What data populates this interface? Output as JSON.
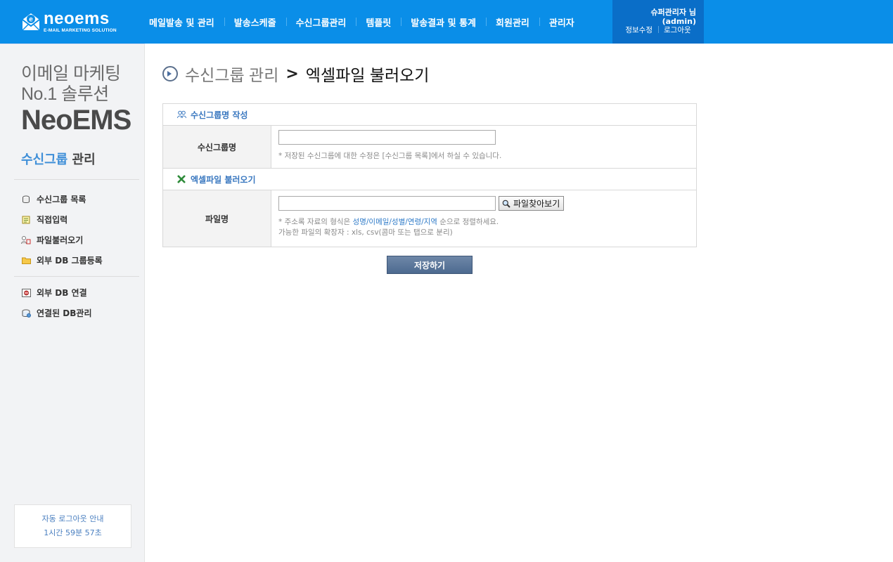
{
  "header": {
    "logo_name": "neoems",
    "logo_sub": "E-MAIL MARKETING SOLUTION",
    "nav": [
      "메일발송 및 관리",
      "발송스케줄",
      "수신그룹관리",
      "템플릿",
      "발송결과 및 통계",
      "회원관리",
      "관리자"
    ],
    "user": {
      "name": "슈퍼관리자 님",
      "id": "(admin)",
      "links": [
        "정보수정",
        "로그아웃"
      ]
    }
  },
  "sidebar": {
    "promo": [
      "이메일 마케팅",
      "No.1 솔루션",
      "NeoEMS"
    ],
    "title_a": "수신그룹",
    "title_b": "관리",
    "menu1": [
      "수신그룹 목록",
      "직접입력",
      "파일불러오기",
      "외부 DB 그룹등록"
    ],
    "menu2": [
      "외부 DB 연결",
      "연결된 DB관리"
    ],
    "logout_notice": "자동 로그아웃 안내",
    "logout_timer": "1시간 59분 57초"
  },
  "main": {
    "title_a": "수신그룹 관리",
    "title_sep": ">",
    "title_b": "엑셀파일 불러오기",
    "sec1": {
      "head": "수신그룹명 작성",
      "label": "수신그룹명",
      "value": "",
      "note": "* 저장된 수신그룹에 대한 수정은 [수신그룹 목록]에서 하실 수 있습니다."
    },
    "sec2": {
      "head": "엑셀파일 불러오기",
      "label": "파일명",
      "value": "",
      "browse": "파일찾아보기",
      "note_a": "* 주소록 자료의 형식은 ",
      "note_hl": "성명/이메일/성별/연령/지역",
      "note_b": " 순으로 정렬하세요.",
      "note2": "가능한 파일의 확장자 : xls, csv(콤마 또는 탭으로 분리)"
    },
    "save": "저장하기"
  },
  "colors": {
    "header_bg": "#0a8ee8",
    "user_bg": "#0a6ec8",
    "accent": "#3f8fd8",
    "save_bg": "#5a7599"
  }
}
